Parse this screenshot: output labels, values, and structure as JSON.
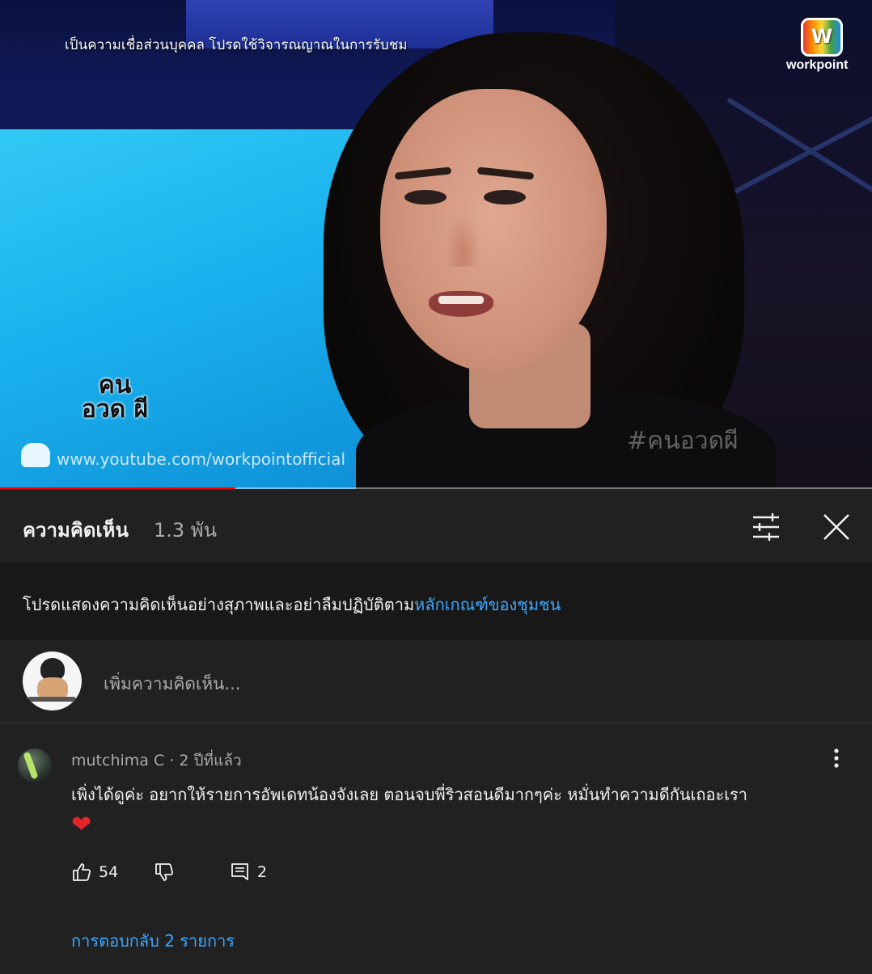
{
  "video": {
    "disclaimer": "เป็นความเชื่อส่วนบุคคล โปรดใช้วิจารณญาณในการรับชม",
    "channel_logo_text": "workpoint",
    "show_logo_text": "คน อวด ผี",
    "hashtag": "#คนอวดผี",
    "watermark": "www.youtube.com/workpointofficial",
    "progress_percent": 27
  },
  "comments_panel": {
    "title": "ความคิดเห็น",
    "count": "1.3 พัน",
    "guidelines_text": "โปรดแสดงความคิดเห็นอย่างสุภาพและอย่าลืมปฏิบัติตาม",
    "guidelines_link": "หลักเกณฑ์ของชุมชน",
    "add_comment_placeholder": "เพิ่มความคิดเห็น..."
  },
  "comment": {
    "author": "mutchima C",
    "time": "2 ปีที่แล้ว",
    "text": "เพิ่งได้ดูค่ะ อยากให้รายการอัพเดทน้องจังเลย  ตอนจบพี่ริวสอนดีมากๆค่ะ หมั่นทำความดีกันเถอะเรา",
    "emoji": "❤",
    "likes": "54",
    "reply_count": "2",
    "view_replies": "การตอบกลับ 2 รายการ"
  },
  "colors": {
    "background": "#212121",
    "guidelines_bg": "#181818",
    "link": "#3ea6ff",
    "progress": "#ff0000",
    "muted_text": "#aaaaaa"
  },
  "icons": {
    "filter": "sliders-icon",
    "close": "close-icon",
    "more": "more-vert-icon",
    "like": "thumb-up-icon",
    "dislike": "thumb-down-icon",
    "reply": "comment-icon"
  }
}
